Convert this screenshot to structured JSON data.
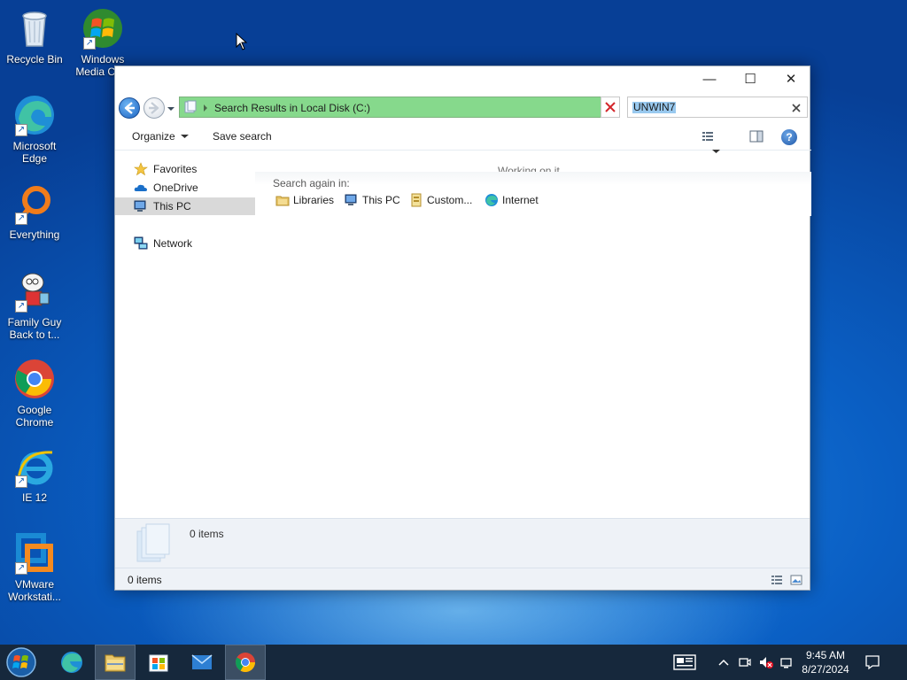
{
  "desktop": {
    "icons": [
      {
        "label": "Recycle Bin"
      },
      {
        "label": "Windows Media Ce..."
      },
      {
        "label": "Microsoft Edge"
      },
      {
        "label": "Everything"
      },
      {
        "label": "Family Guy Back to t..."
      },
      {
        "label": "Google Chrome"
      },
      {
        "label": "IE 12"
      },
      {
        "label": "VMware Workstati..."
      }
    ]
  },
  "window": {
    "controls": {
      "minimize": "—",
      "maximize": "☐",
      "close": "✕"
    },
    "address": {
      "path": "Search Results in Local Disk (C:)",
      "highlight_color": "#86d98c"
    },
    "search": {
      "value": "UNWIN7"
    },
    "toolbar": {
      "organize": "Organize",
      "save_search": "Save search"
    },
    "nav": {
      "favorites": "Favorites",
      "onedrive": "OneDrive",
      "this_pc": "This PC",
      "network": "Network"
    },
    "content": {
      "working": "Working on it...",
      "search_again": "Search again in:",
      "locations": [
        "Libraries",
        "This PC",
        "Custom...",
        "Internet"
      ]
    },
    "details": {
      "count": "0 items"
    },
    "status": {
      "count": "0 items"
    }
  },
  "taskbar": {
    "time": "9:45 AM",
    "date": "8/27/2024"
  }
}
